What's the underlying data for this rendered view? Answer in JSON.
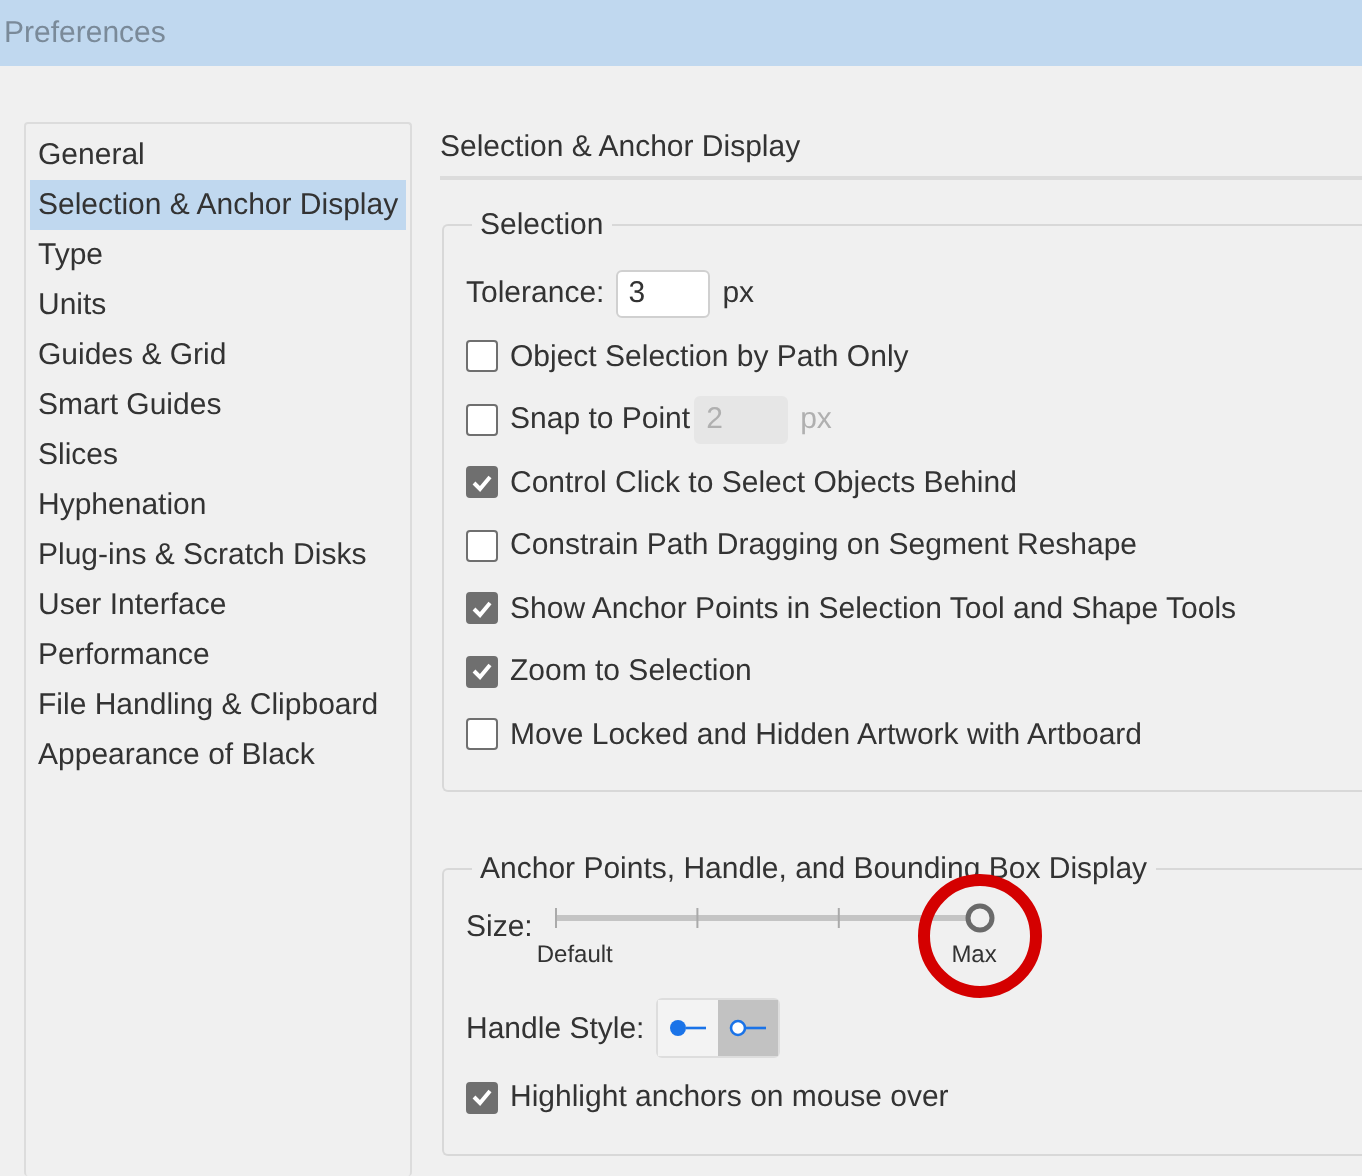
{
  "window": {
    "title": "Preferences"
  },
  "sidebar": {
    "items": [
      {
        "label": "General",
        "selected": false
      },
      {
        "label": "Selection & Anchor Display",
        "selected": true
      },
      {
        "label": "Type",
        "selected": false
      },
      {
        "label": "Units",
        "selected": false
      },
      {
        "label": "Guides & Grid",
        "selected": false
      },
      {
        "label": "Smart Guides",
        "selected": false
      },
      {
        "label": "Slices",
        "selected": false
      },
      {
        "label": "Hyphenation",
        "selected": false
      },
      {
        "label": "Plug-ins & Scratch Disks",
        "selected": false
      },
      {
        "label": "User Interface",
        "selected": false
      },
      {
        "label": "Performance",
        "selected": false
      },
      {
        "label": "File Handling & Clipboard",
        "selected": false
      },
      {
        "label": "Appearance of Black",
        "selected": false
      }
    ]
  },
  "panel": {
    "heading": "Selection & Anchor Display",
    "selection": {
      "legend": "Selection",
      "tolerance": {
        "label": "Tolerance:",
        "value": "3",
        "unit": "px"
      },
      "options": [
        {
          "label": "Object Selection by Path Only",
          "checked": false
        },
        {
          "label": "Snap to Point",
          "checked": false,
          "field": {
            "value": "2",
            "unit": "px",
            "disabled": true
          }
        },
        {
          "label": "Control Click to Select Objects Behind",
          "checked": true
        },
        {
          "label": "Constrain Path Dragging on Segment Reshape",
          "checked": false
        },
        {
          "label": "Show Anchor Points in Selection Tool and Shape Tools",
          "checked": true
        },
        {
          "label": "Zoom to Selection",
          "checked": true
        },
        {
          "label": "Move Locked and Hidden Artwork with Artboard",
          "checked": false
        }
      ]
    },
    "anchor": {
      "legend": "Anchor Points, Handle, and Bounding Box Display",
      "size": {
        "label": "Size:",
        "level": 1,
        "min_label": "Default",
        "max_label": "Max"
      },
      "handle_style": {
        "label": "Handle Style:",
        "options": [
          {
            "kind": "filled",
            "selected": false
          },
          {
            "kind": "hollow",
            "selected": true
          }
        ]
      },
      "options": [
        {
          "label": "Highlight anchors on mouse over",
          "checked": true
        }
      ]
    }
  }
}
